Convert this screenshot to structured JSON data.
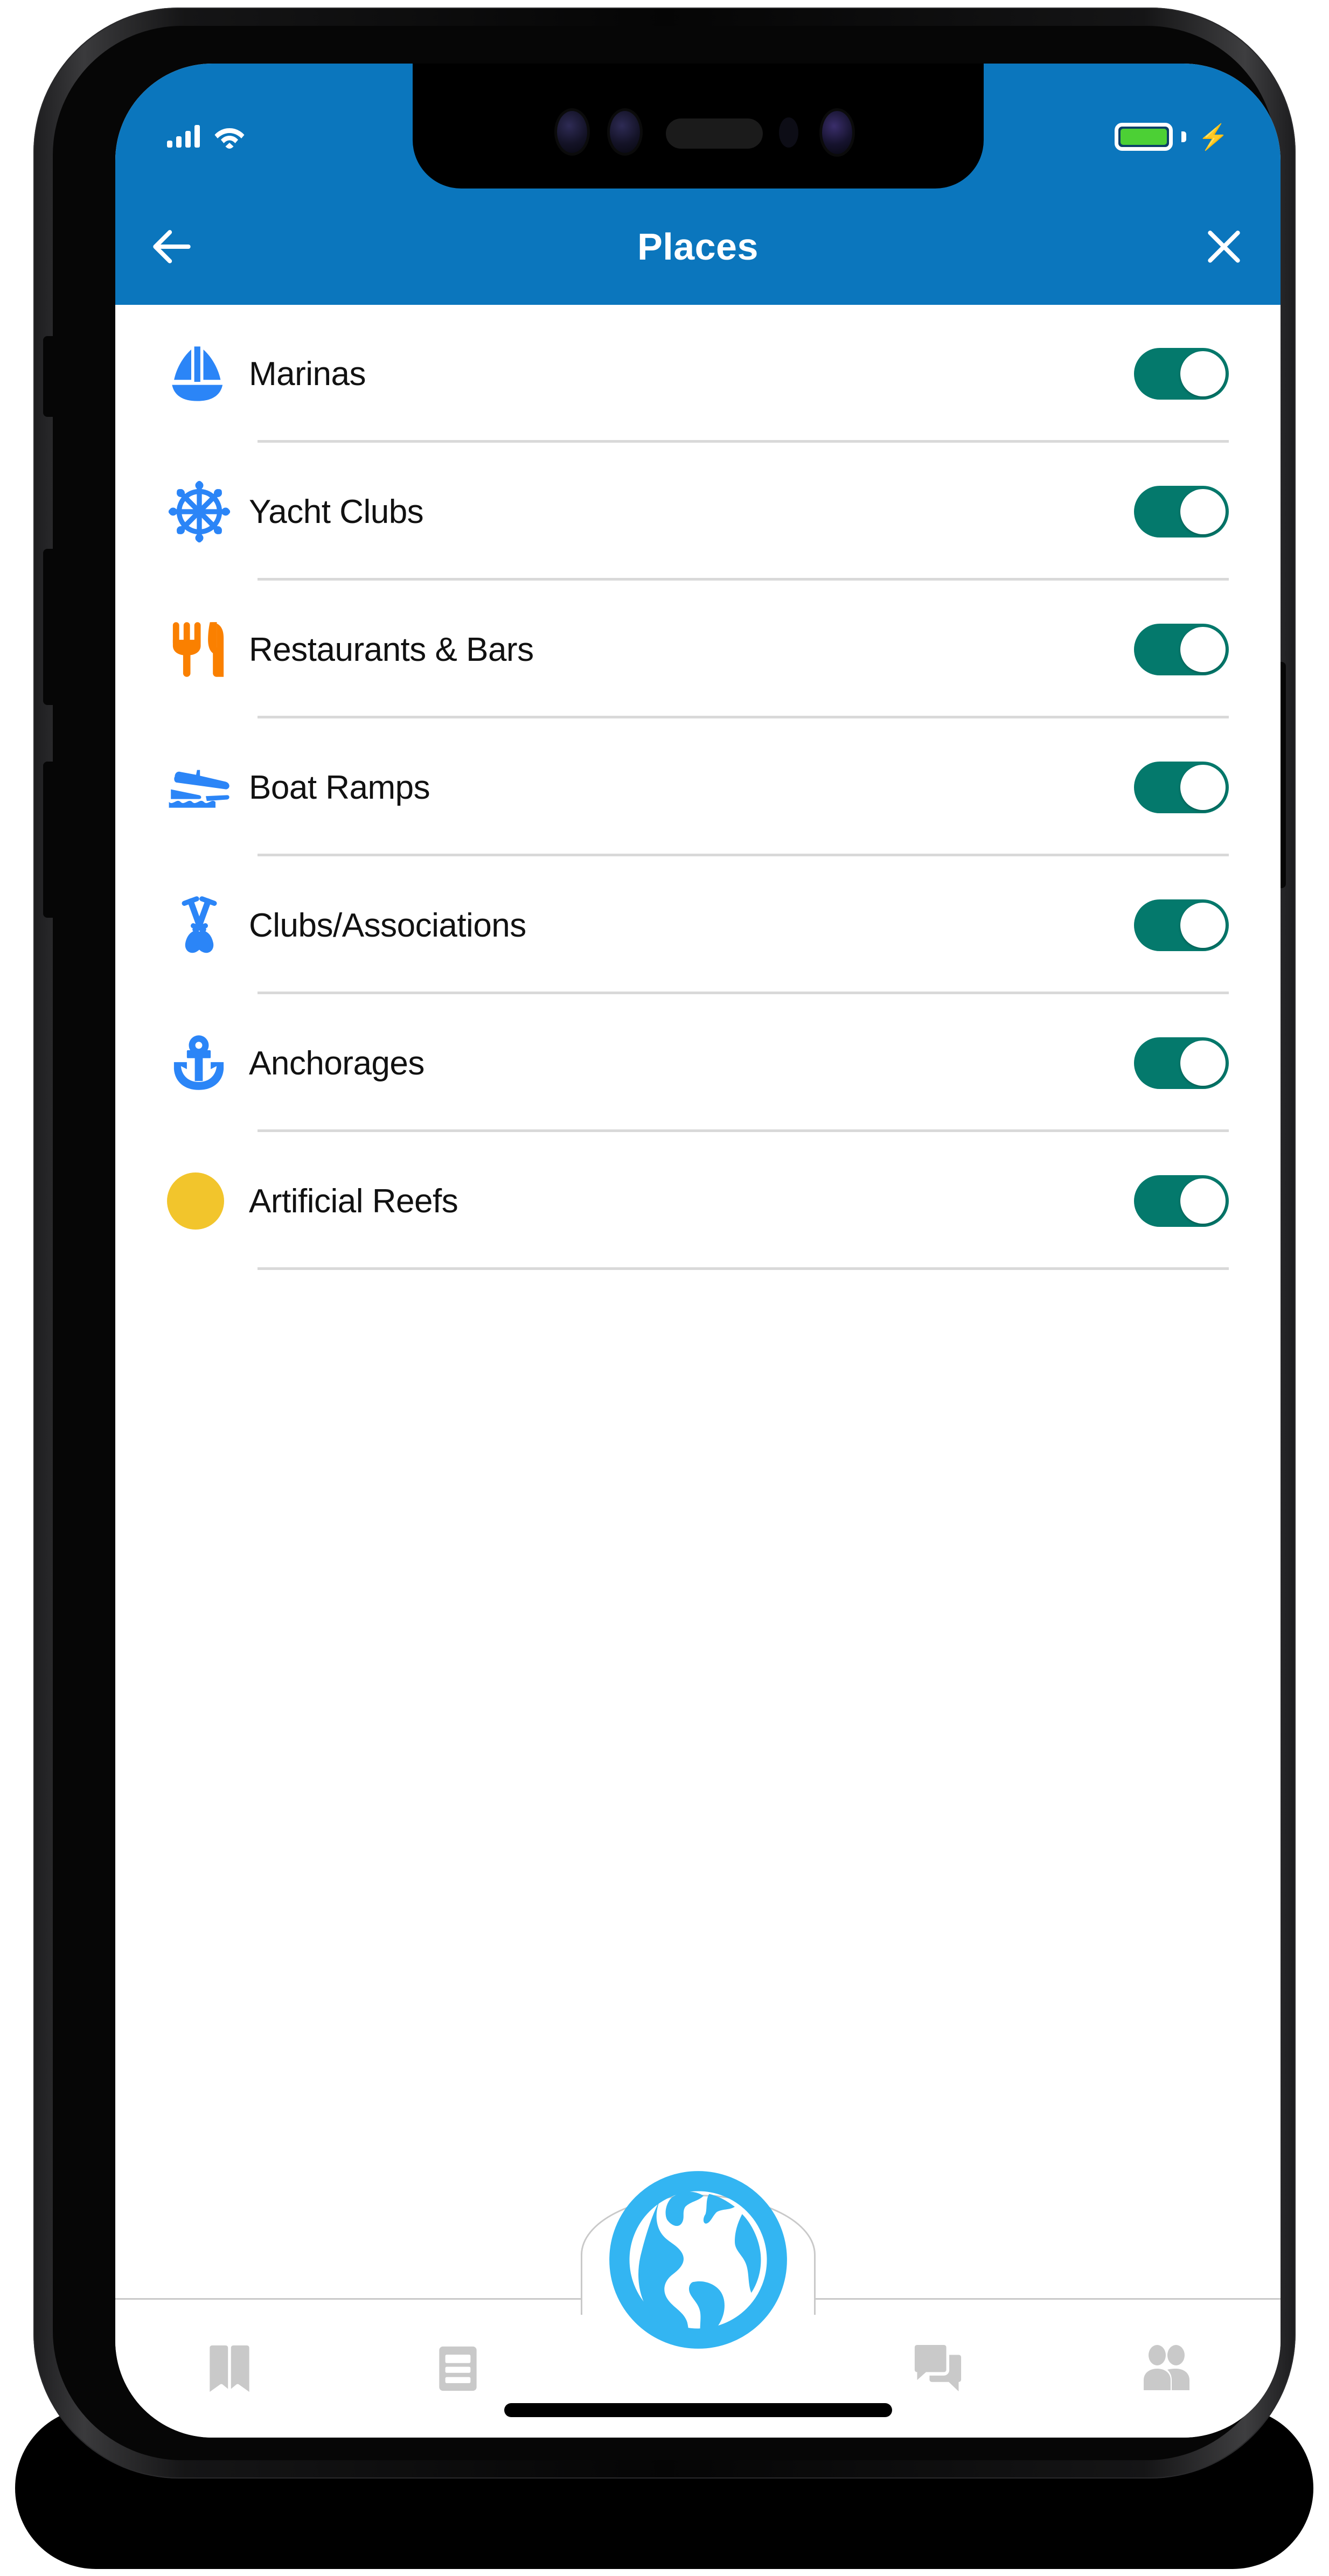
{
  "statusbar": {
    "signal_icon": "cellular-signal-icon",
    "wifi_icon": "wifi-icon",
    "battery_icon": "battery-full-icon",
    "charging_icon": "charging-bolt-icon",
    "battery_color": "#4cd035"
  },
  "header": {
    "title": "Places",
    "back_icon": "arrow-left-icon",
    "close_icon": "close-x-icon",
    "bg_color": "#0b76bd",
    "text_color": "#ffffff"
  },
  "list": {
    "items": [
      {
        "label": "Marinas",
        "icon": "sailboat-icon",
        "icon_color": "#2b85f7",
        "toggle": "on"
      },
      {
        "label": "Yacht Clubs",
        "icon": "ships-wheel-icon",
        "icon_color": "#2b85f7",
        "toggle": "on"
      },
      {
        "label": "Restaurants & Bars",
        "icon": "fork-knife-icon",
        "icon_color": "#fa8000",
        "toggle": "on"
      },
      {
        "label": "Boat Ramps",
        "icon": "boat-ramp-icon",
        "icon_color": "#2b85f7",
        "toggle": "on"
      },
      {
        "label": "Clubs/Associations",
        "icon": "crossed-oars-icon",
        "icon_color": "#2b85f7",
        "toggle": "on"
      },
      {
        "label": "Anchorages",
        "icon": "anchor-icon",
        "icon_color": "#2b85f7",
        "toggle": "on"
      },
      {
        "label": "Artificial Reefs",
        "icon": "yellow-circle-icon",
        "icon_color": "#f2c52c",
        "toggle": "on"
      }
    ],
    "toggle_on_color": "#04796c",
    "toggle_knob_color": "#ffffff",
    "divider_color": "#d9d9d9",
    "label_color": "#111111"
  },
  "tabbar": {
    "items": [
      {
        "icon": "book-icon",
        "active": "false"
      },
      {
        "icon": "list-icon",
        "active": "false"
      },
      {
        "icon": "globe-icon",
        "active": "true"
      },
      {
        "icon": "chat-icon",
        "active": "false"
      },
      {
        "icon": "people-icon",
        "active": "false"
      }
    ],
    "inactive_color": "#c9c9c9",
    "active_color": "#33b5f2"
  },
  "device": {
    "home_indicator": "home-indicator",
    "notch": "camera-notch",
    "buttons": [
      "silent-switch",
      "volume-down-button",
      "volume-up-button",
      "power-button"
    ]
  }
}
